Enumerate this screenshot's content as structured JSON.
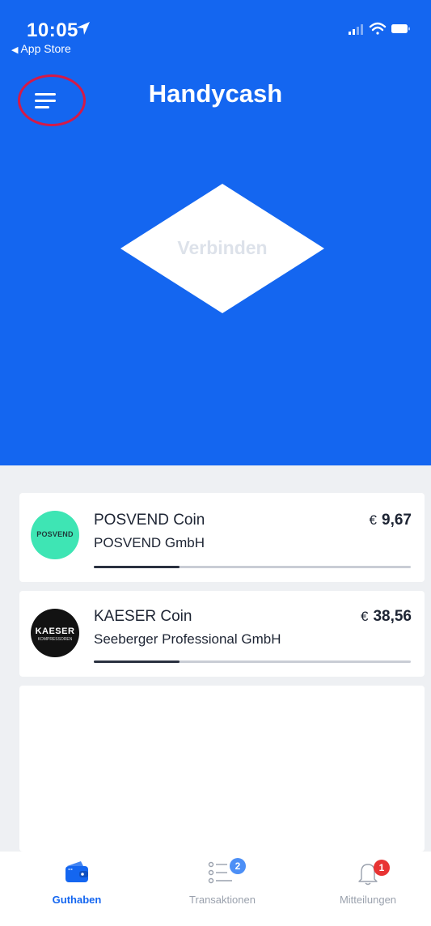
{
  "status_bar": {
    "time": "10:05",
    "back_app": "App Store"
  },
  "header": {
    "title": "Handycash",
    "connect_label": "Verbinden",
    "accent_color": "#1466f0"
  },
  "coins": [
    {
      "name": "POSVEND Coin",
      "company": "POSVEND GmbH",
      "currency": "€",
      "amount": "9,67",
      "logo_text": "POSVEND",
      "logo_color": "#3ee5b4",
      "progress": 0.27
    },
    {
      "name": "KAESER Coin",
      "company": "Seeberger Professional GmbH",
      "currency": "€",
      "amount": "38,56",
      "logo_text": "KAESER",
      "logo_subtext": "KOMPRESSOREN",
      "logo_color": "#121212",
      "progress": 0.27
    }
  ],
  "tabbar": {
    "tabs": [
      {
        "label": "Guthaben",
        "icon": "wallet-icon",
        "active": true
      },
      {
        "label": "Transaktionen",
        "icon": "list-icon",
        "badge": "2"
      },
      {
        "label": "Mitteilungen",
        "icon": "bell-icon",
        "badge": "1"
      }
    ]
  }
}
